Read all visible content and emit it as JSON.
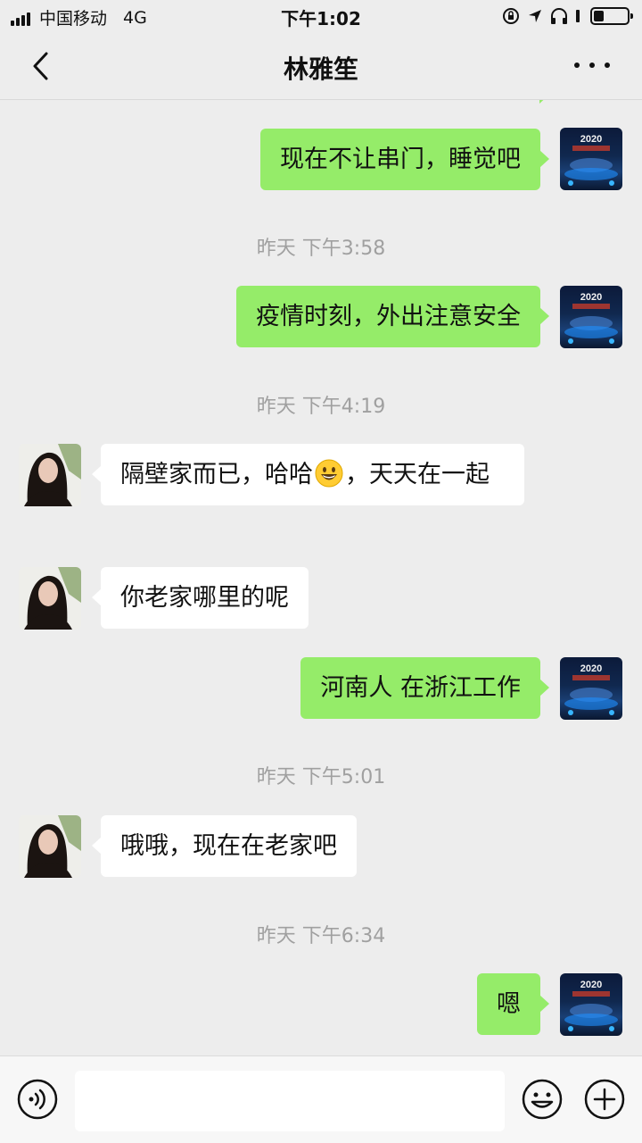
{
  "status_bar": {
    "carrier": "中国移动",
    "network": "4G",
    "time": "下午1:02",
    "battery_level": 0.3
  },
  "header": {
    "title": "林雅笙",
    "back_icon": "chevron-left-icon",
    "more_icon": "more-dots-icon"
  },
  "messages": [
    {
      "type": "time",
      "text": "昨天 下午3:58"
    },
    {
      "type": "time",
      "text": "昨天 下午4:19"
    },
    {
      "type": "time",
      "text": "昨天 下午5:01"
    },
    {
      "type": "time",
      "text": "昨天 下午6:34"
    },
    {
      "type": "text",
      "from": "me",
      "text": "现在不让串门，睡觉吧"
    },
    {
      "type": "text",
      "from": "me",
      "text": "疫情时刻，外出注意安全"
    },
    {
      "type": "text",
      "from": "them",
      "text_before": "隔壁家而已，哈哈",
      "emoji": "grinning-face",
      "text_after": "，天天在一起"
    },
    {
      "type": "text",
      "from": "them",
      "text": "你老家哪里的呢"
    },
    {
      "type": "text",
      "from": "me",
      "text": "河南人 在浙江工作"
    },
    {
      "type": "text",
      "from": "them",
      "text": "哦哦，现在在老家吧"
    },
    {
      "type": "text",
      "from": "me",
      "text": "嗯"
    }
  ],
  "avatar_me_text": "2020",
  "input_bar": {
    "voice_icon": "voice-icon",
    "emoji_icon": "emoji-icon",
    "plus_icon": "plus-icon",
    "placeholder": ""
  },
  "colors": {
    "background": "#ededed",
    "my_bubble": "#95ec69",
    "their_bubble": "#ffffff",
    "timestamp": "#a0a0a0"
  }
}
